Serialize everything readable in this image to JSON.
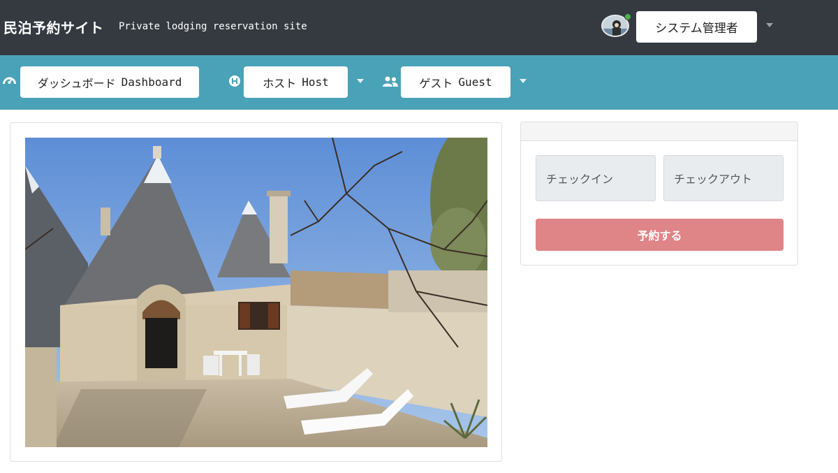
{
  "header": {
    "brand": "民泊予約サイト",
    "subtitle": "Private lodging reservation site",
    "user_label": "システム管理者",
    "online_status_color": "#4caf50"
  },
  "nav": {
    "dashboard": {
      "label_ja": "ダッシュボード",
      "label_en": "Dashboard",
      "icon": "tachometer-icon"
    },
    "host": {
      "label_ja": "ホスト",
      "label_en": "Host",
      "icon": "h-circle-icon"
    },
    "guest": {
      "label_ja": "ゲスト",
      "label_en": "Guest",
      "icon": "users-icon"
    }
  },
  "reservation": {
    "checkin_placeholder": "チェックイン",
    "checkout_placeholder": "チェックアウト",
    "submit_label": "予約する"
  },
  "colors": {
    "header_bg": "#343a40",
    "nav_bg": "#4aa2b8",
    "reserve_button": "#df8487"
  }
}
